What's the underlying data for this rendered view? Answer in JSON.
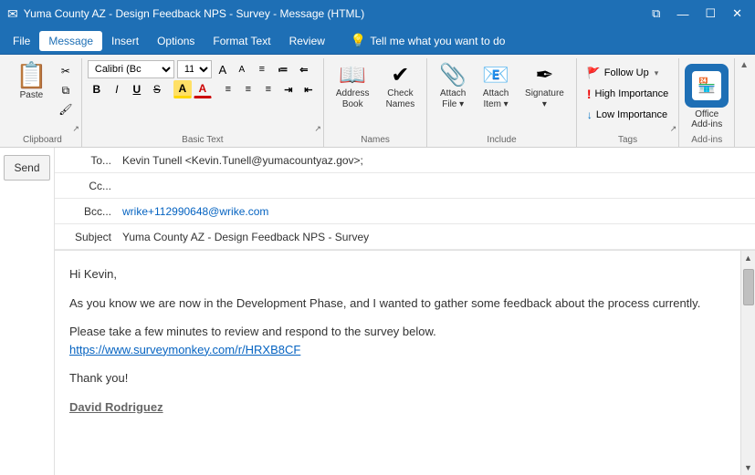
{
  "titleBar": {
    "title": "Yuma County AZ - Design Feedback NPS - Survey - Message (HTML)",
    "icons": [
      "restore-icon",
      "minimize-icon",
      "close-icon"
    ]
  },
  "menuBar": {
    "items": [
      "File",
      "Message",
      "Insert",
      "Options",
      "Format Text",
      "Review"
    ],
    "activeItem": "Message",
    "tellMe": "Tell me what you want to do"
  },
  "ribbon": {
    "groups": [
      {
        "name": "Clipboard",
        "label": "Clipboard",
        "buttons": {
          "paste": "Paste",
          "cut": "✂",
          "copy": "⧉",
          "formatPainter": "🖌"
        }
      },
      {
        "name": "BasicText",
        "label": "Basic Text",
        "fontName": "Calibri (Bc",
        "fontSize": "11",
        "buttons": {
          "bold": "B",
          "italic": "I",
          "underline": "U",
          "strikethrough": "S",
          "highlight": "A",
          "fontColor": "A"
        }
      },
      {
        "name": "Names",
        "label": "Names",
        "buttons": {
          "addressBook": "Address Book",
          "checkNames": "Check Names"
        }
      },
      {
        "name": "Include",
        "label": "Include",
        "buttons": {
          "attachFile": "Attach File",
          "attachItem": "Attach Item",
          "signature": "Signature"
        }
      },
      {
        "name": "Tags",
        "label": "Tags",
        "buttons": {
          "followUp": "Follow Up",
          "highImportance": "High Importance",
          "lowImportance": "Low Importance"
        }
      },
      {
        "name": "AddIns",
        "label": "Add-ins",
        "buttons": {
          "officeAddins": "Office Add-ins"
        }
      }
    ]
  },
  "emailFields": {
    "toLabel": "To...",
    "toValue": "Kevin Tunell <Kevin.Tunell@yumacountyaz.gov>;",
    "ccLabel": "Cc...",
    "ccValue": "",
    "bccLabel": "Bcc...",
    "bccValue": "wrike+112990648@wrike.com",
    "subjectLabel": "Subject",
    "subjectValue": "Yuma County AZ - Design Feedback NPS - Survey"
  },
  "sendButton": "Send",
  "emailBody": {
    "paragraph1": "Hi Kevin,",
    "paragraph2": "As you know we are now in the Development Phase, and I wanted to gather some feedback about the process currently.",
    "paragraph3": "Please take a few minutes to review and respond to the survey below.",
    "surveyLink": "https://www.surveymonkey.com/r/HRXB8CF",
    "paragraph4": "Thank you!",
    "paragraph5": "David Rodriguez"
  }
}
